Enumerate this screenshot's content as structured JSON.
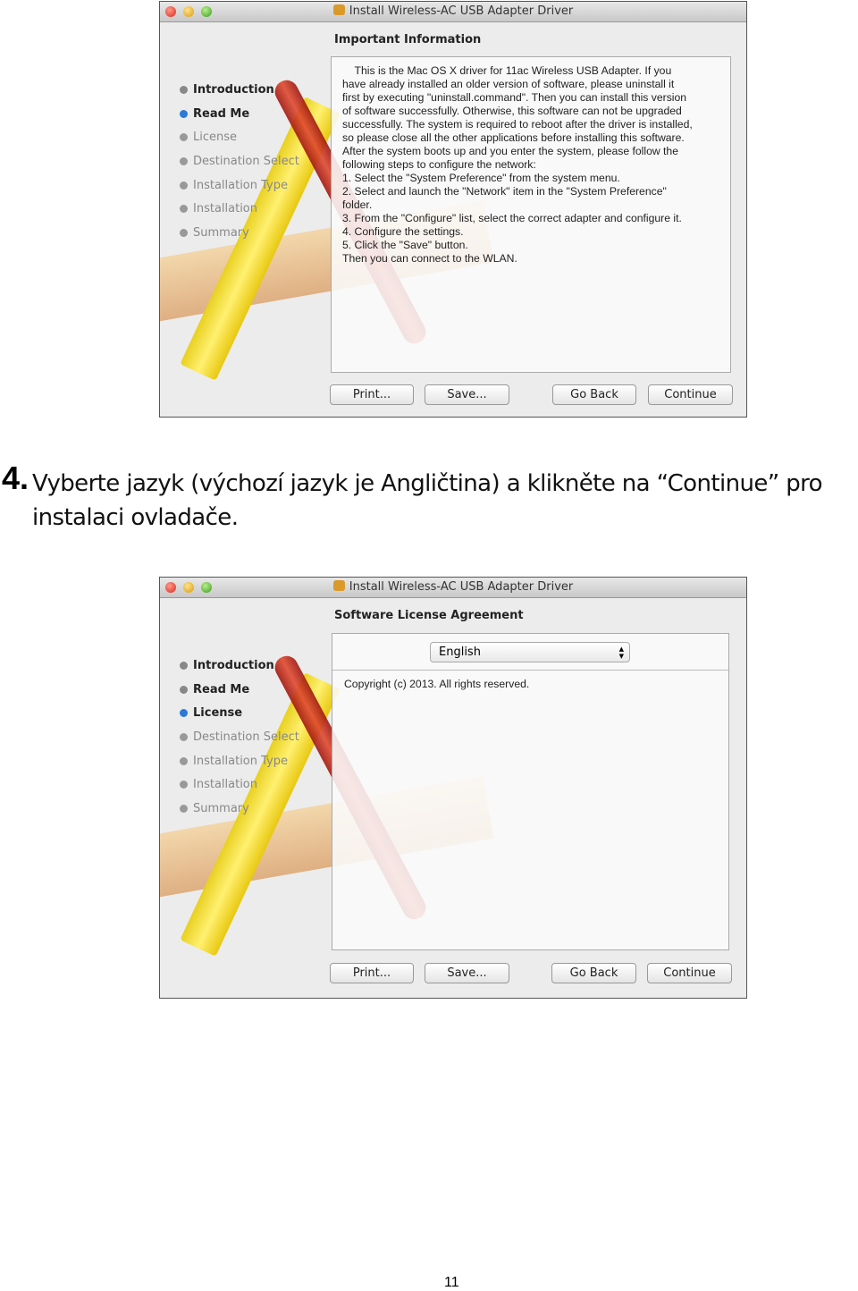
{
  "window_title": "Install Wireless-AC USB Adapter Driver",
  "steps": [
    "Introduction",
    "Read Me",
    "License",
    "Destination Select",
    "Installation Type",
    "Installation",
    "Summary"
  ],
  "buttons": {
    "print": "Print...",
    "save": "Save...",
    "go_back": "Go Back",
    "continue": "Continue"
  },
  "screen1": {
    "heading": "Important Information",
    "current_step": "Read Me",
    "readme": "    This is the Mac OS X driver for 11ac Wireless USB Adapter. If you\nhave already installed an older version of software, please uninstall it\nfirst by executing \"uninstall.command\". Then you can install this version\nof software successfully. Otherwise, this software can not be upgraded\nsuccessfully. The system is required to reboot after the driver is installed,\nso please close all the other applications before installing this software.\nAfter the system boots up and you enter the system, please follow the\nfollowing steps to configure the network:\n1. Select the \"System Preference\" from the system menu.\n2. Select and launch the \"Network\" item in the \"System Preference\"\nfolder.\n3. From the \"Configure\" list, select the correct adapter and configure it.\n4. Configure the settings.\n5. Click the \"Save\" button.\nThen you can connect to the WLAN."
  },
  "instruction": {
    "number": "4.",
    "text": "Vyberte jazyk (výchozí jazyk je Angličtina) a klikněte na “Continue” pro instalaci ovladače."
  },
  "screen2": {
    "heading": "Software License Agreement",
    "current_step": "License",
    "language": "English",
    "copyright": "Copyright (c) 2013.  All rights reserved."
  },
  "page_number": "11",
  "colors": {
    "current_step": "#2a7ad8"
  }
}
